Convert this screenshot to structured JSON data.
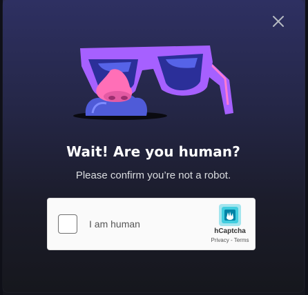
{
  "modal": {
    "close_icon": "close-icon",
    "illustration": "disguise-glasses-mascot",
    "title": "Wait! Are you human?",
    "subtitle": "Please confirm you’re not a robot."
  },
  "captcha": {
    "checkbox_label": "I am human",
    "checked": false,
    "brand": "hCaptcha",
    "privacy_link": "Privacy",
    "separator": " - ",
    "terms_link": "Terms",
    "brand_icon": "hcaptcha-hand-icon"
  },
  "colors": {
    "accent_purple": "#a660ff",
    "nose_pink": "#ff6fb7",
    "hcaptcha_teal": "#00bdd6"
  }
}
